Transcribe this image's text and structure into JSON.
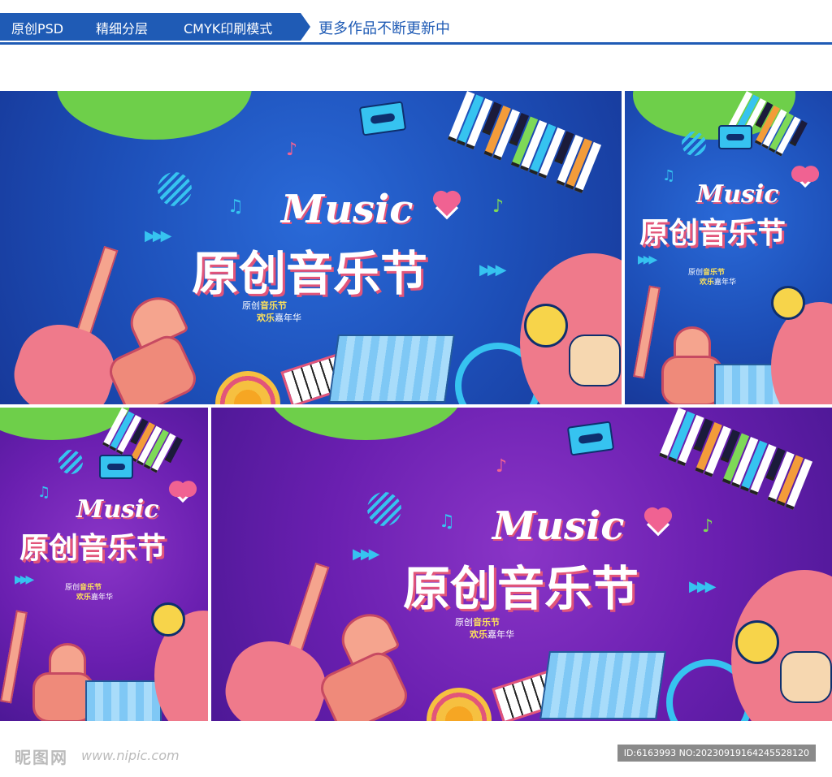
{
  "header": {
    "tags": [
      "原创PSD",
      "精细分层",
      "CMYK印刷模式"
    ],
    "more": "更多作品不断更新中"
  },
  "poster": {
    "music": "Music",
    "title": "原创音乐节",
    "sub_line1_a": "原创",
    "sub_line1_b": "音乐节",
    "sub_line2_a": "欢乐",
    "sub_line2_b": "嘉年华"
  },
  "footer": {
    "logo": "昵图网",
    "site": "www.nipic.com",
    "id": "ID:6163993 NO:20230919164245528120"
  },
  "colors": {
    "brand": "#1f5bb5",
    "blue_bg": "#1d4fb8",
    "purple_bg": "#6a1fb0",
    "accent_pink": "#e2557a",
    "accent_green": "#6ecf4a"
  }
}
